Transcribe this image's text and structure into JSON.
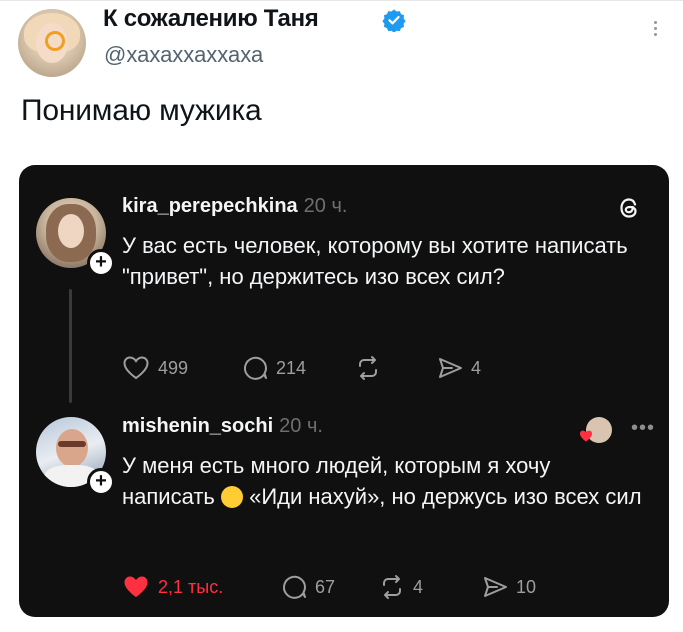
{
  "tweet": {
    "author_name": "К сожалению Таня",
    "handle": "@хахаххаххаха",
    "text": "Понимаю мужика"
  },
  "threads_card": {
    "post1": {
      "username": "kira_perepechkina",
      "time": "20 ч.",
      "text": "У вас есть человек, которому вы хотите написать \"привет\", но держитесь изо всех сил?",
      "likes": "499",
      "comments": "214",
      "shares": "4"
    },
    "post2": {
      "username": "mishenin_sochi",
      "time": "20 ч.",
      "text_before_emoji": "У меня есть много людей, которым я хочу написать ",
      "text_after_emoji": " «Иди нахуй», но держусь изо всех сил",
      "likes": "2,1 тыс.",
      "comments": "67",
      "reposts": "4",
      "shares": "10"
    }
  },
  "icons": {
    "verified": "verified-badge-icon",
    "more": "more-vertical-icon",
    "threads": "threads-logo-icon",
    "like": "heart-icon",
    "comment": "comment-icon",
    "repost": "repost-icon",
    "share": "share-icon"
  },
  "colors": {
    "verified_blue": "#1d9bf0",
    "card_bg": "#101010",
    "liked_red": "#ff3040"
  }
}
